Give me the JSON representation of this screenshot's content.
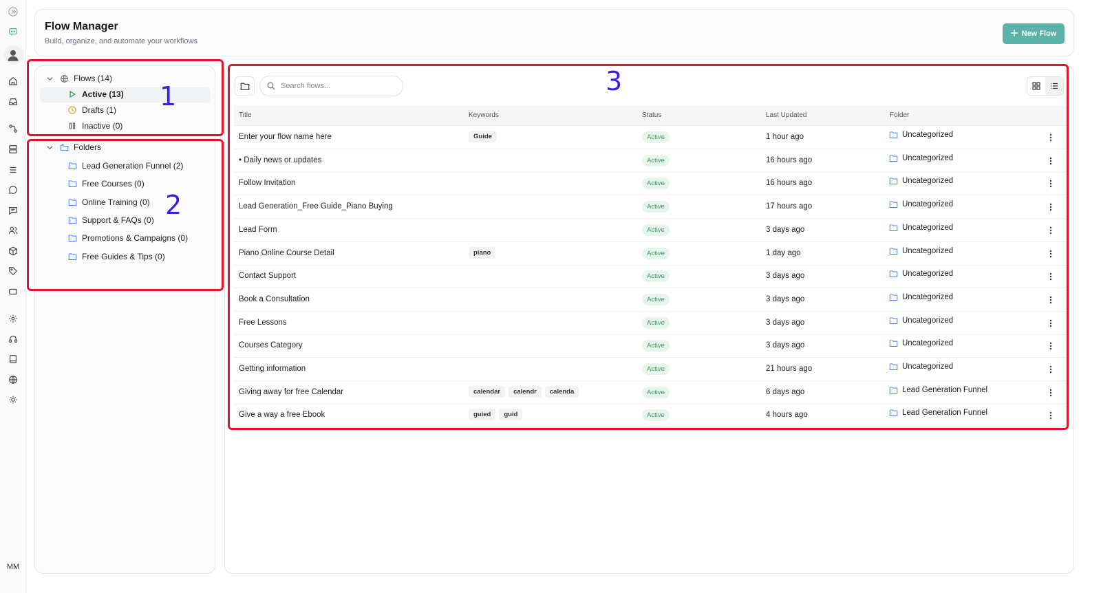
{
  "app": {
    "title": "Flow Manager",
    "subtitle": "Build, organize, and automate your workflows",
    "new_flow_label": "New Flow",
    "user_initials": "MM"
  },
  "rail_icons": [
    "collapse-icon",
    "chat-bot-icon",
    "user-avatar-icon",
    "home-icon",
    "inbox-icon",
    "flow-icon",
    "layers-icon",
    "list-icon",
    "chat-bubble-icon",
    "message-icon",
    "users-icon",
    "cube-icon",
    "tag-icon",
    "card-icon",
    "settings-icon",
    "headset-icon",
    "book-icon",
    "globe-icon",
    "theme-icon"
  ],
  "tree": {
    "flows_label": "Flows (14)",
    "active_label": "Active (13)",
    "drafts_label": "Drafts (1)",
    "inactive_label": "Inactive (0)",
    "folders_label": "Folders",
    "folders": [
      "Lead Generation Funnel (2)",
      "Free Courses (0)",
      "Online Training (0)",
      "Support & FAQs (0)",
      "Promotions & Campaigns (0)",
      "Free Guides & Tips (0)"
    ]
  },
  "search": {
    "placeholder": "Search flows..."
  },
  "table": {
    "headers": {
      "title": "Title",
      "keywords": "Keywords",
      "status": "Status",
      "updated": "Last Updated",
      "folder": "Folder"
    },
    "rows": [
      {
        "title": "Enter your flow name here",
        "keywords": [
          "Guide"
        ],
        "status": "Active",
        "updated": "1 hour ago",
        "folder": "Uncategorized"
      },
      {
        "title": "• Daily news or updates",
        "keywords": [],
        "status": "Active",
        "updated": "16 hours ago",
        "folder": "Uncategorized"
      },
      {
        "title": "Follow Invitation",
        "keywords": [],
        "status": "Active",
        "updated": "16 hours ago",
        "folder": "Uncategorized"
      },
      {
        "title": "Lead Generation_Free Guide_Piano Buying",
        "keywords": [],
        "status": "Active",
        "updated": "17 hours ago",
        "folder": "Uncategorized"
      },
      {
        "title": "Lead Form",
        "keywords": [],
        "status": "Active",
        "updated": "3 days ago",
        "folder": "Uncategorized"
      },
      {
        "title": "Piano Online Course Detail",
        "keywords": [
          "piano"
        ],
        "status": "Active",
        "updated": "1 day ago",
        "folder": "Uncategorized"
      },
      {
        "title": "Contact Support",
        "keywords": [],
        "status": "Active",
        "updated": "3 days ago",
        "folder": "Uncategorized"
      },
      {
        "title": "Book a Consultation",
        "keywords": [],
        "status": "Active",
        "updated": "3 days ago",
        "folder": "Uncategorized"
      },
      {
        "title": "Free Lessons",
        "keywords": [],
        "status": "Active",
        "updated": "3 days ago",
        "folder": "Uncategorized"
      },
      {
        "title": "Courses Category",
        "keywords": [],
        "status": "Active",
        "updated": "3 days ago",
        "folder": "Uncategorized"
      },
      {
        "title": "Getting information",
        "keywords": [],
        "status": "Active",
        "updated": "21 hours ago",
        "folder": "Uncategorized"
      },
      {
        "title": "Giving away for free Calendar",
        "keywords": [
          "calendar",
          "calendr",
          "calenda"
        ],
        "status": "Active",
        "updated": "6 days ago",
        "folder": "Lead Generation Funnel"
      },
      {
        "title": "Give a way a free Ebook",
        "keywords": [
          "guied",
          "guid"
        ],
        "status": "Active",
        "updated": "4 hours ago",
        "folder": "Lead Generation Funnel"
      }
    ]
  },
  "annotations": [
    "1",
    "2",
    "3"
  ],
  "colors": {
    "accent": "#5bb3a7",
    "annotation": "#e0152f",
    "annotation_number": "#3b1fe0",
    "status_bg": "#e6f6ec",
    "status_text": "#3f9a63",
    "folder_icon": "#3b82f6"
  }
}
